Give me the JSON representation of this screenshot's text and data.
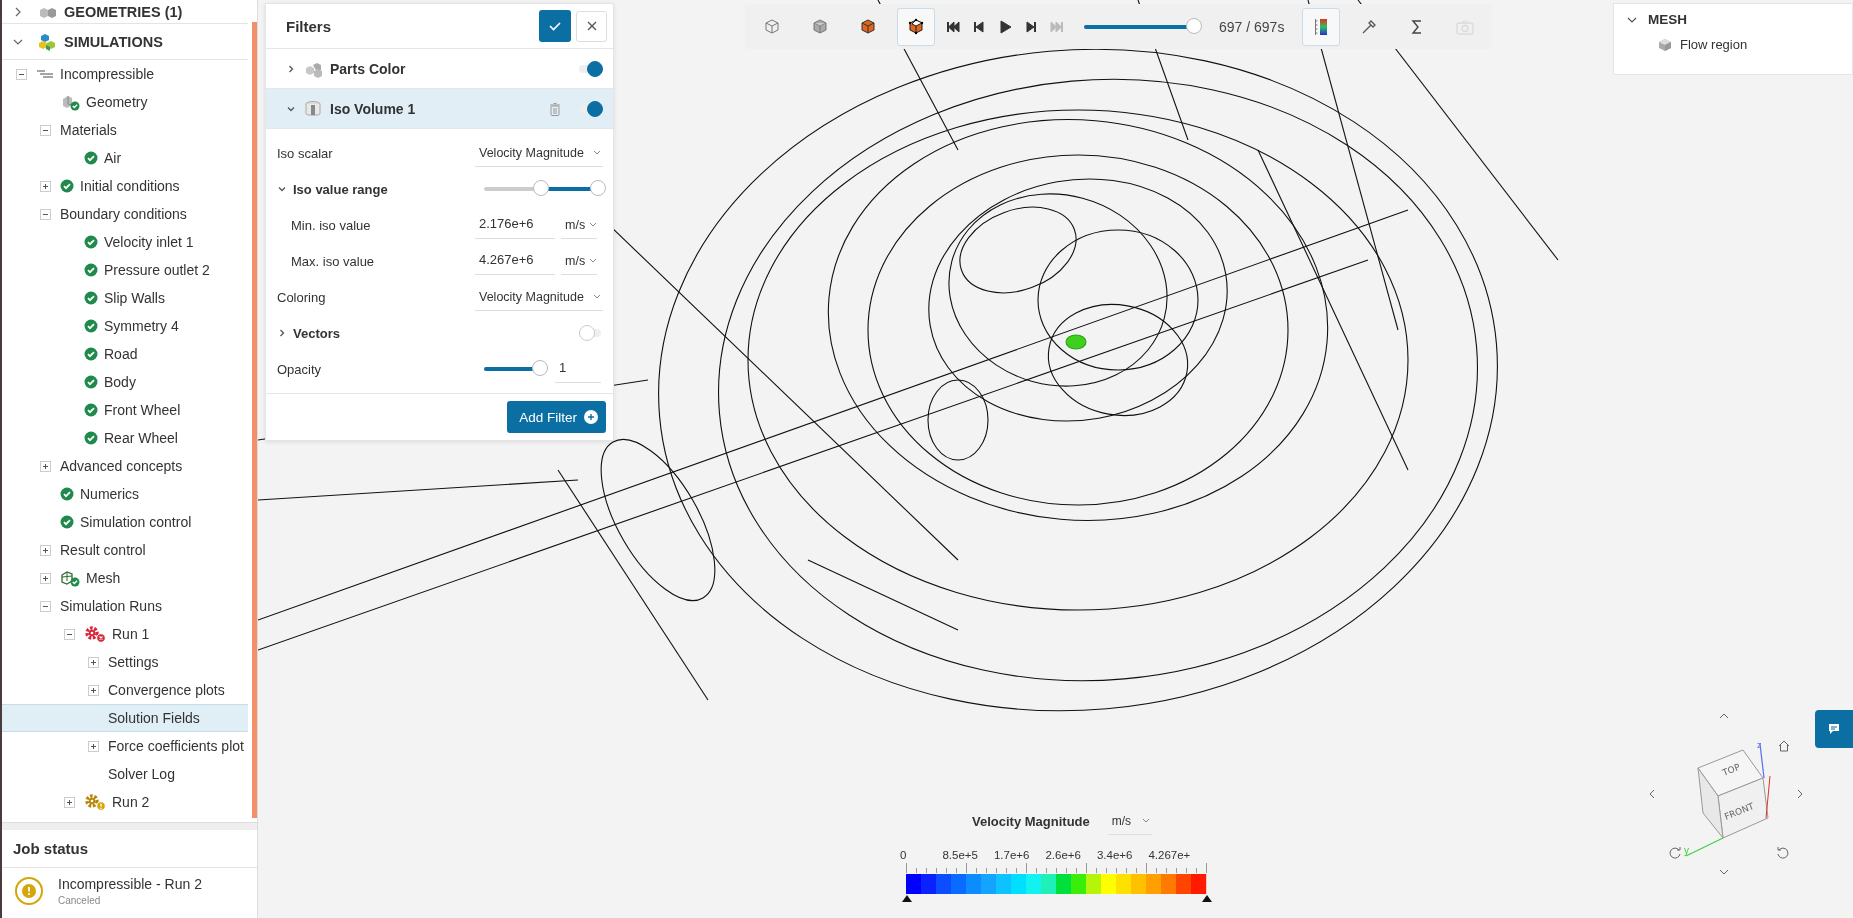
{
  "tree": [
    {
      "label": "GEOMETRIES (1)",
      "kind": "section",
      "expanded": false,
      "selected": false
    },
    {
      "label": "SIMULATIONS",
      "kind": "section",
      "expanded": true,
      "selected": false,
      "children": [
        {
          "label": "Incompressible",
          "kind": "simulation",
          "expanded": true,
          "selected": false,
          "children": [
            {
              "label": "Geometry",
              "kind": "geometry",
              "selected": false
            },
            {
              "label": "Materials",
              "expanded": true,
              "selected": false,
              "children": [
                {
                  "label": "Air",
                  "kind": "setting",
                  "selected": false
                }
              ]
            },
            {
              "label": "Initial conditions",
              "kind": "setting",
              "expanded": false,
              "selected": false
            },
            {
              "label": "Boundary conditions",
              "expanded": true,
              "selected": false,
              "children": [
                {
                  "label": "Velocity inlet 1",
                  "kind": "setting",
                  "selected": false
                },
                {
                  "label": "Pressure outlet 2",
                  "kind": "setting",
                  "selected": false
                },
                {
                  "label": "Slip Walls",
                  "kind": "setting",
                  "selected": false
                },
                {
                  "label": "Symmetry 4",
                  "kind": "setting",
                  "selected": false
                },
                {
                  "label": "Road",
                  "kind": "setting",
                  "selected": false
                },
                {
                  "label": "Body",
                  "kind": "setting",
                  "selected": false
                },
                {
                  "label": "Front Wheel",
                  "kind": "setting",
                  "selected": false
                },
                {
                  "label": "Rear Wheel",
                  "kind": "setting",
                  "selected": false
                }
              ]
            },
            {
              "label": "Advanced concepts",
              "expanded": false,
              "selected": false
            },
            {
              "label": "Numerics",
              "kind": "setting",
              "selected": false
            },
            {
              "label": "Simulation control",
              "kind": "setting",
              "selected": false
            },
            {
              "label": "Result control",
              "expanded": false,
              "selected": false
            },
            {
              "label": "Mesh",
              "kind": "mesh",
              "expanded": false,
              "selected": false
            },
            {
              "label": "Simulation Runs",
              "expanded": true,
              "selected": false,
              "children": [
                {
                  "label": "Run 1",
                  "kind": "run",
                  "failed": true,
                  "expanded": true,
                  "selected": false,
                  "children": [
                    {
                      "label": "Settings",
                      "expanded": false,
                      "selected": false
                    },
                    {
                      "label": "Convergence plots",
                      "expanded": false,
                      "selected": false
                    },
                    {
                      "label": "Solution Fields",
                      "selected": true
                    },
                    {
                      "label": "Force coefficients plot",
                      "expanded": false,
                      "selected": false
                    },
                    {
                      "label": "Solver Log",
                      "selected": false
                    }
                  ]
                },
                {
                  "label": "Run 2",
                  "kind": "run",
                  "failed": false,
                  "expanded": false,
                  "selected": false
                }
              ]
            }
          ]
        }
      ]
    }
  ],
  "job_status": {
    "title": "Job status",
    "jobs": [
      {
        "name": "Incompressible - Run 2",
        "status": "Canceled"
      }
    ]
  },
  "filters": {
    "title": "Filters",
    "items": [
      {
        "label": "Parts Color",
        "expanded": false,
        "selected": false,
        "on": true
      },
      {
        "label": "Iso Volume 1",
        "expanded": true,
        "selected": true,
        "on": true
      }
    ],
    "properties": [
      {
        "kind": "select",
        "label": "Iso scalar",
        "value": "Velocity Magnitude"
      },
      {
        "kind": "range",
        "label": "Iso value range",
        "expanded": true,
        "thumbs": [
          {
            "level": 0.5
          },
          {
            "level": 1
          }
        ],
        "children": [
          {
            "kind": "value",
            "label": "Min. iso value",
            "value": "2.176e+6",
            "unit": "m/s"
          },
          {
            "kind": "value",
            "label": "Max. iso value",
            "value": "4.267e+6",
            "unit": "m/s"
          }
        ]
      },
      {
        "kind": "select",
        "label": "Coloring",
        "value": "Velocity Magnitude"
      },
      {
        "kind": "toggle",
        "label": "Vectors",
        "expanded": false,
        "on": false
      },
      {
        "kind": "slider",
        "label": "Opacity",
        "level": 1,
        "value": "1"
      }
    ],
    "add_button": "Add Filter"
  },
  "toolbar": {
    "view_modes": [
      {
        "selected": false
      },
      {
        "selected": false
      },
      {
        "selected": false
      },
      {
        "selected": true
      }
    ],
    "playback": [
      {
        "disabled": false
      },
      {
        "disabled": false
      },
      {
        "disabled": false
      },
      {
        "disabled": false
      },
      {
        "disabled": true
      }
    ],
    "time_slider": {
      "level": 1
    },
    "time": "697 / 697s",
    "tools": [
      {
        "selected": true,
        "disabled": false
      },
      {
        "selected": false,
        "disabled": false
      },
      {
        "selected": false,
        "disabled": false
      },
      {
        "selected": false,
        "disabled": true
      }
    ]
  },
  "scene_tree": {
    "title": "MESH",
    "expanded": true,
    "items": [
      {
        "label": "Flow region"
      }
    ]
  },
  "legend": {
    "title": "Velocity Magnitude",
    "unit": "m/s",
    "ticks": [
      "0",
      "8.5e+5",
      "1.7e+6",
      "2.6e+6",
      "3.4e+6",
      "4.267e+"
    ]
  },
  "view_cube": {
    "faces": [
      "TOP",
      "FRONT"
    ],
    "axes": [
      "z",
      "y"
    ]
  }
}
